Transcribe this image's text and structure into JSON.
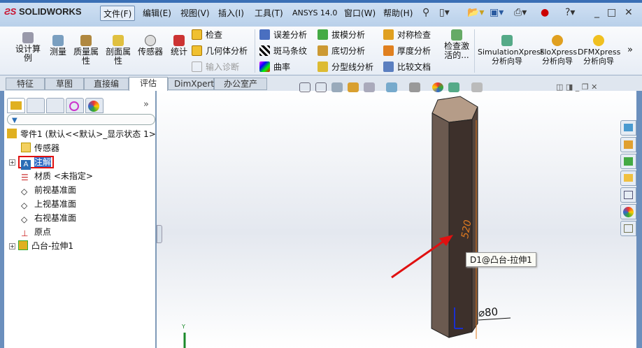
{
  "app": {
    "logo": "SOLIDWORKS"
  },
  "menu": [
    "文件(F)",
    "编辑(E)",
    "视图(V)",
    "插入(I)",
    "工具(T)",
    "ANSYS 14.0",
    "窗口(W)",
    "帮助(H)"
  ],
  "ribbon": {
    "design_study": "设计算例",
    "measure": "测量",
    "mass_props": "质量属性",
    "section_props": "剖面属性",
    "sensor": "传感器",
    "statistics": "统计",
    "check": "检查",
    "geometry_analysis": "几何体分析",
    "import_diag": "输入诊断",
    "deviation": "误差分析",
    "zebra": "斑马条纹",
    "curvature": "曲率",
    "draft": "拔模分析",
    "undercut": "底切分析",
    "parting_line": "分型线分析",
    "symmetry": "对称检查",
    "thickness": "厚度分析",
    "compare": "比较文档",
    "check_active": "检查激活的...",
    "simx1": "SimulationXpress",
    "simx2": "分析向导",
    "flox1": "FloXpress",
    "flox2": "分析向导",
    "dfm1": "DFMXpress",
    "dfm2": "分析向导"
  },
  "tabs": [
    "特征",
    "草图",
    "直接编辑",
    "评估",
    "DimXpert",
    "办公室产品"
  ],
  "active_tab": "评估",
  "tree": {
    "root": "零件1  (默认<<默认>_显示状态 1>",
    "items": [
      "传感器",
      "注解",
      "材质 <未指定>",
      "前视基准面",
      "上视基准面",
      "右视基准面",
      "原点",
      "凸台-拉伸1"
    ],
    "selected": "注解"
  },
  "viewport": {
    "dimension_height": "520",
    "dimension_diameter": "⌀80",
    "tooltip": "D1@凸台-拉伸1",
    "axis_y": "Y"
  },
  "colors": {
    "highlight": "#e01010",
    "dimension": "#e07a20",
    "body": "#4a3b34"
  }
}
